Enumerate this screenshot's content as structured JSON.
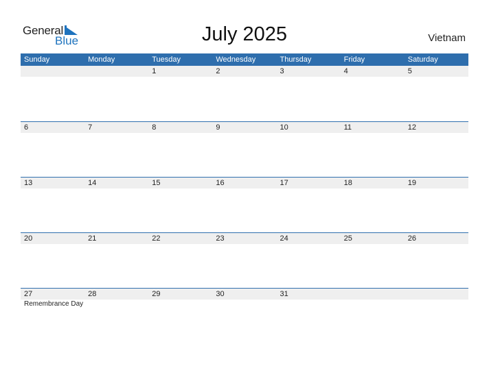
{
  "logo": {
    "line1": "General",
    "line2": "Blue"
  },
  "title": "July 2025",
  "country": "Vietnam",
  "weekdays": [
    "Sunday",
    "Monday",
    "Tuesday",
    "Wednesday",
    "Thursday",
    "Friday",
    "Saturday"
  ],
  "weeks": [
    {
      "days": [
        "",
        "",
        "1",
        "2",
        "3",
        "4",
        "5"
      ],
      "events": [
        "",
        "",
        "",
        "",
        "",
        "",
        ""
      ]
    },
    {
      "days": [
        "6",
        "7",
        "8",
        "9",
        "10",
        "11",
        "12"
      ],
      "events": [
        "",
        "",
        "",
        "",
        "",
        "",
        ""
      ]
    },
    {
      "days": [
        "13",
        "14",
        "15",
        "16",
        "17",
        "18",
        "19"
      ],
      "events": [
        "",
        "",
        "",
        "",
        "",
        "",
        ""
      ]
    },
    {
      "days": [
        "20",
        "21",
        "22",
        "23",
        "24",
        "25",
        "26"
      ],
      "events": [
        "",
        "",
        "",
        "",
        "",
        "",
        ""
      ]
    },
    {
      "days": [
        "27",
        "28",
        "29",
        "30",
        "31",
        "",
        ""
      ],
      "events": [
        "Remembrance Day",
        "",
        "",
        "",
        "",
        "",
        ""
      ]
    }
  ],
  "colors": {
    "accent": "#2e6ead",
    "brand_blue": "#1e73be",
    "date_row_bg": "#efefef"
  }
}
